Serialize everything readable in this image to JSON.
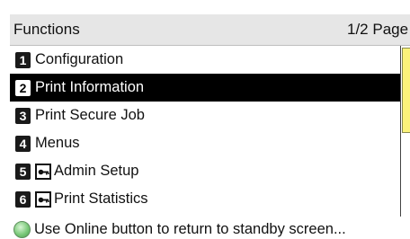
{
  "header": {
    "title": "Functions",
    "page_indicator": "1/2 Page"
  },
  "menu": {
    "items": [
      {
        "number": "1",
        "label": "Configuration",
        "selected": false,
        "locked": false
      },
      {
        "number": "2",
        "label": "Print Information",
        "selected": true,
        "locked": false
      },
      {
        "number": "3",
        "label": "Print Secure Job",
        "selected": false,
        "locked": false
      },
      {
        "number": "4",
        "label": "Menus",
        "selected": false,
        "locked": false
      },
      {
        "number": "5",
        "label": "Admin Setup",
        "selected": false,
        "locked": true
      },
      {
        "number": "6",
        "label": "Print Statistics",
        "selected": false,
        "locked": true
      }
    ]
  },
  "status": {
    "message": "Use Online button to return to standby screen...",
    "icon": "online-button-icon"
  },
  "scrollbar": {
    "position_fraction": 0.0,
    "visible_fraction": 0.5,
    "thumb_color": "#fbf27a"
  },
  "colors": {
    "selected_background": "#000000",
    "selected_text": "#ffffff",
    "header_background": "#e6e6e6"
  }
}
